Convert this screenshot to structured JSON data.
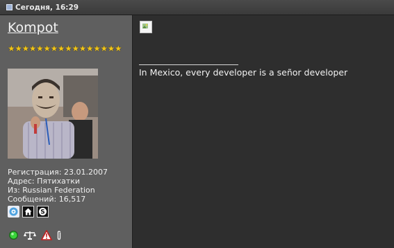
{
  "header": {
    "timestamp": "Сегодня, 16:29"
  },
  "user": {
    "name": "Kompot",
    "stars": "★★★★★★★★★★★★★★★★",
    "star_color": "#f0c419",
    "registration": "Регистрация: 23.01.2007",
    "address": "Адрес: Пятихатки",
    "from": "Из: Russian Federation",
    "posts": "Сообщений: 16,517"
  },
  "user_icons": [
    "icq-icon",
    "home-icon",
    "skype-icon"
  ],
  "action_icons": [
    "online-status-icon",
    "reputation-scales-icon",
    "report-warning-icon",
    "attachment-icon"
  ],
  "post": {
    "signature": "In Mexico, every developer is a señor developer"
  }
}
